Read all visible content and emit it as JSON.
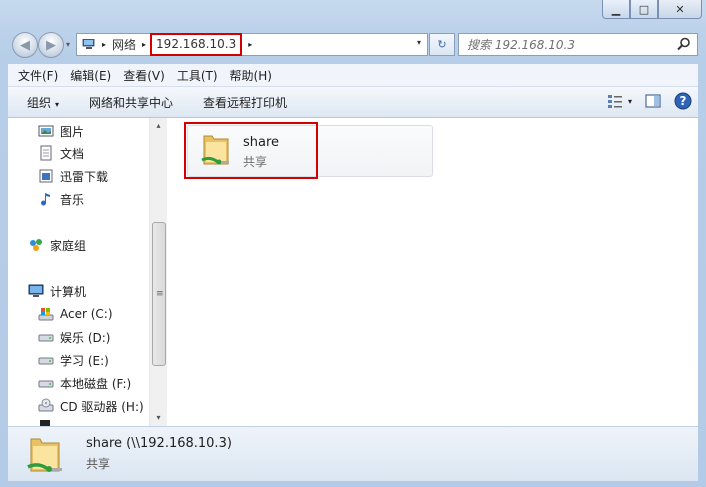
{
  "window": {
    "minimize_glyph": "▁",
    "maximize_glyph": "□",
    "close_glyph": "✕"
  },
  "address_bar": {
    "crumbs": [
      "网络",
      "192.168.10.3"
    ],
    "separator_glyph": "▸",
    "dropdown_glyph": "▾",
    "refresh_glyph": "↻",
    "search_placeholder": "搜索 192.168.10.3"
  },
  "nav_buttons": {
    "back_glyph": "◀",
    "forward_glyph": "▶",
    "recent_glyph": "▾"
  },
  "menu": {
    "items": [
      "文件(F)",
      "编辑(E)",
      "查看(V)",
      "工具(T)",
      "帮助(H)"
    ]
  },
  "toolbar": {
    "organize_label": "组织",
    "organize_caret": "▾",
    "network_center_label": "网络和共享中心",
    "remote_printers_label": "查看远程打印机",
    "view_caret": "▾"
  },
  "nav_pane": {
    "items": [
      {
        "label": "图片",
        "icon": "pictures-icon"
      },
      {
        "label": "文档",
        "icon": "documents-icon"
      },
      {
        "label": "迅雷下载",
        "icon": "download-folder-icon"
      },
      {
        "label": "音乐",
        "icon": "music-icon"
      },
      {
        "label": "家庭组",
        "icon": "homegroup-icon"
      },
      {
        "label": "计算机",
        "icon": "computer-icon"
      },
      {
        "label": "Acer (C:)",
        "icon": "system-drive-icon"
      },
      {
        "label": "娱乐 (D:)",
        "icon": "drive-icon"
      },
      {
        "label": "学习 (E:)",
        "icon": "drive-icon"
      },
      {
        "label": "本地磁盘 (F:)",
        "icon": "drive-icon"
      },
      {
        "label": "CD 驱动器 (H:)",
        "icon": "cd-drive-icon"
      }
    ],
    "scroll_up_glyph": "▴",
    "scroll_down_glyph": "▾",
    "grip_glyph": "≡"
  },
  "files": [
    {
      "name": "share",
      "type": "共享"
    }
  ],
  "details": {
    "name": "share (\\\\192.168.10.3)",
    "type": "共享"
  },
  "colors": {
    "highlight_border": "#d40000",
    "chrome": "#bcd2ea"
  }
}
